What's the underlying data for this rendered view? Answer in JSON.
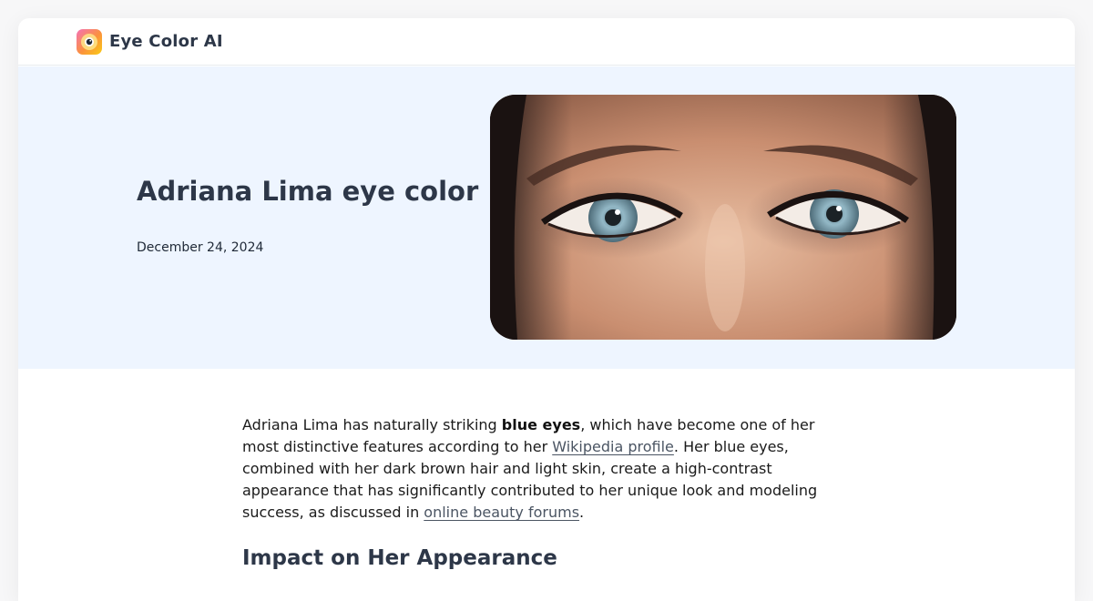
{
  "brand": {
    "name": "Eye Color AI",
    "logo_icon": "eye-logo-icon"
  },
  "hero": {
    "title": "Adriana Lima eye color",
    "date": "December 24, 2024",
    "image_icon": "eyes-photo"
  },
  "article": {
    "intro_1": "Adriana Lima has naturally striking ",
    "intro_bold": "blue eyes",
    "intro_2": ", which have become one of her most distinctive features according to her ",
    "link_wikipedia": "Wikipedia profile",
    "intro_3": ". Her blue eyes, combined with her dark brown hair and light skin, create a high-contrast appearance that has significantly contributed to her unique look and modeling success, as discussed in ",
    "link_forums": "online beauty forums",
    "intro_4": ".",
    "section_heading": "Impact on Her Appearance"
  },
  "colors": {
    "hero_bg": "#eef5ff",
    "heading": "#2d3748",
    "link": "#4b5563",
    "eye_iris": "#8fb4c4"
  }
}
